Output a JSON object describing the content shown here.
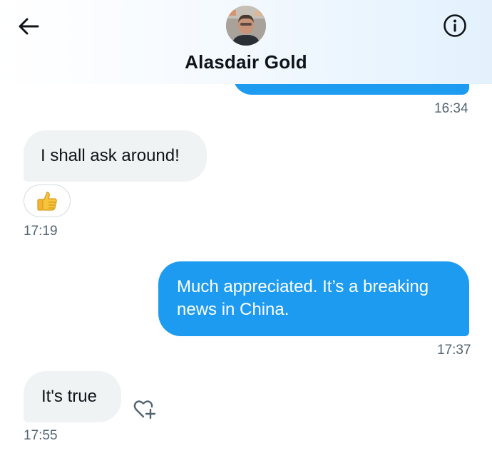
{
  "header": {
    "contact_name": "Alasdair Gold"
  },
  "icons": {
    "back": "arrow-left-icon",
    "info": "info-icon",
    "reaction": "thumbs-up-icon",
    "add_reaction": "heart-plus-icon"
  },
  "colors": {
    "outgoing_bubble": "#1d9bf0",
    "incoming_bubble": "#eff3f4",
    "timestamp": "#536471",
    "text": "#0f1419"
  },
  "messages": [
    {
      "direction": "out",
      "text": "",
      "time": "16:34"
    },
    {
      "direction": "in",
      "text": "I shall ask around!",
      "time": "17:19",
      "reaction": "thumbs-up"
    },
    {
      "direction": "out",
      "text_lines": [
        "Much appreciated. It’s a breaking",
        "news in China."
      ],
      "time": "17:37"
    },
    {
      "direction": "in",
      "text": "It's true",
      "time": "17:55"
    }
  ]
}
